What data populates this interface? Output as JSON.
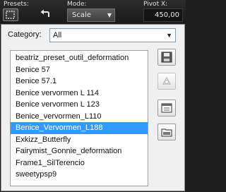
{
  "toolbar": {
    "presets_label": "Presets:",
    "mode_label": "Mode:",
    "mode_value": "Scale",
    "pivot_label": "Pivot X:",
    "pivot_value": "450,00"
  },
  "popup": {
    "category_label": "Category:",
    "category_value": "All",
    "items": [
      "beatriz_preset_outil_deformation",
      "Benice 57",
      "Benice 57.1",
      "Benice vervormen L 114",
      "Benice vervormen L 123",
      "Benice_vervormen_L110",
      "Benice_Vervormen_L188",
      "Exkizz_Butterfly",
      "Fairymist_Gonnie_deformation",
      "Frame1_SilTerencio",
      "sweetypsp9"
    ],
    "selected_index": 6,
    "side_buttons": [
      "save-preset-icon",
      "delete-preset-icon",
      "preset-options-icon",
      "open-folder-icon"
    ]
  }
}
